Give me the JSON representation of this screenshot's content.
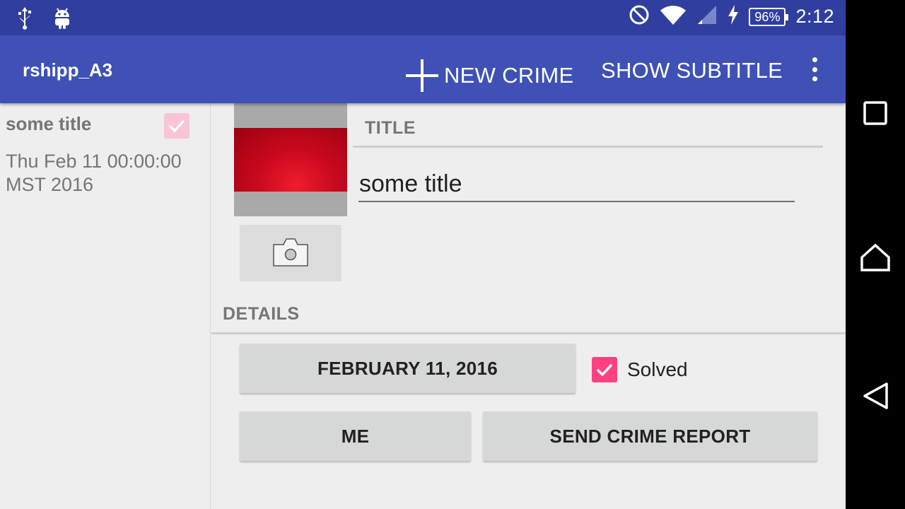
{
  "status_bar": {
    "icons_left": [
      "usb-icon",
      "android-debug-icon"
    ],
    "icons_right": [
      "do-not-disturb-icon",
      "wifi-icon",
      "cell-signal-icon",
      "charging-icon"
    ],
    "battery": "96%",
    "time": "2:12"
  },
  "toolbar": {
    "app_title": "rshipp_A3",
    "new_crime_label": "NEW CRIME",
    "show_subtitle_label": "SHOW SUBTITLE",
    "background_color": "#3f51b5"
  },
  "crime_list": {
    "items": [
      {
        "title": "some title",
        "date": "Thu Feb 11 00:00:00 MST 2016",
        "solved": true
      }
    ]
  },
  "crime_detail": {
    "title_header": "TITLE",
    "title_value": "some title",
    "details_header": "DETAILS",
    "date_button_label": "FEBRUARY 11, 2016",
    "solved_label": "Solved",
    "solved": true,
    "suspect_button_label": "ME",
    "report_button_label": "SEND CRIME REPORT",
    "accent_color": "#ff4081"
  },
  "nav_bar": {
    "icons": [
      "recents-icon",
      "home-icon",
      "back-icon"
    ]
  }
}
